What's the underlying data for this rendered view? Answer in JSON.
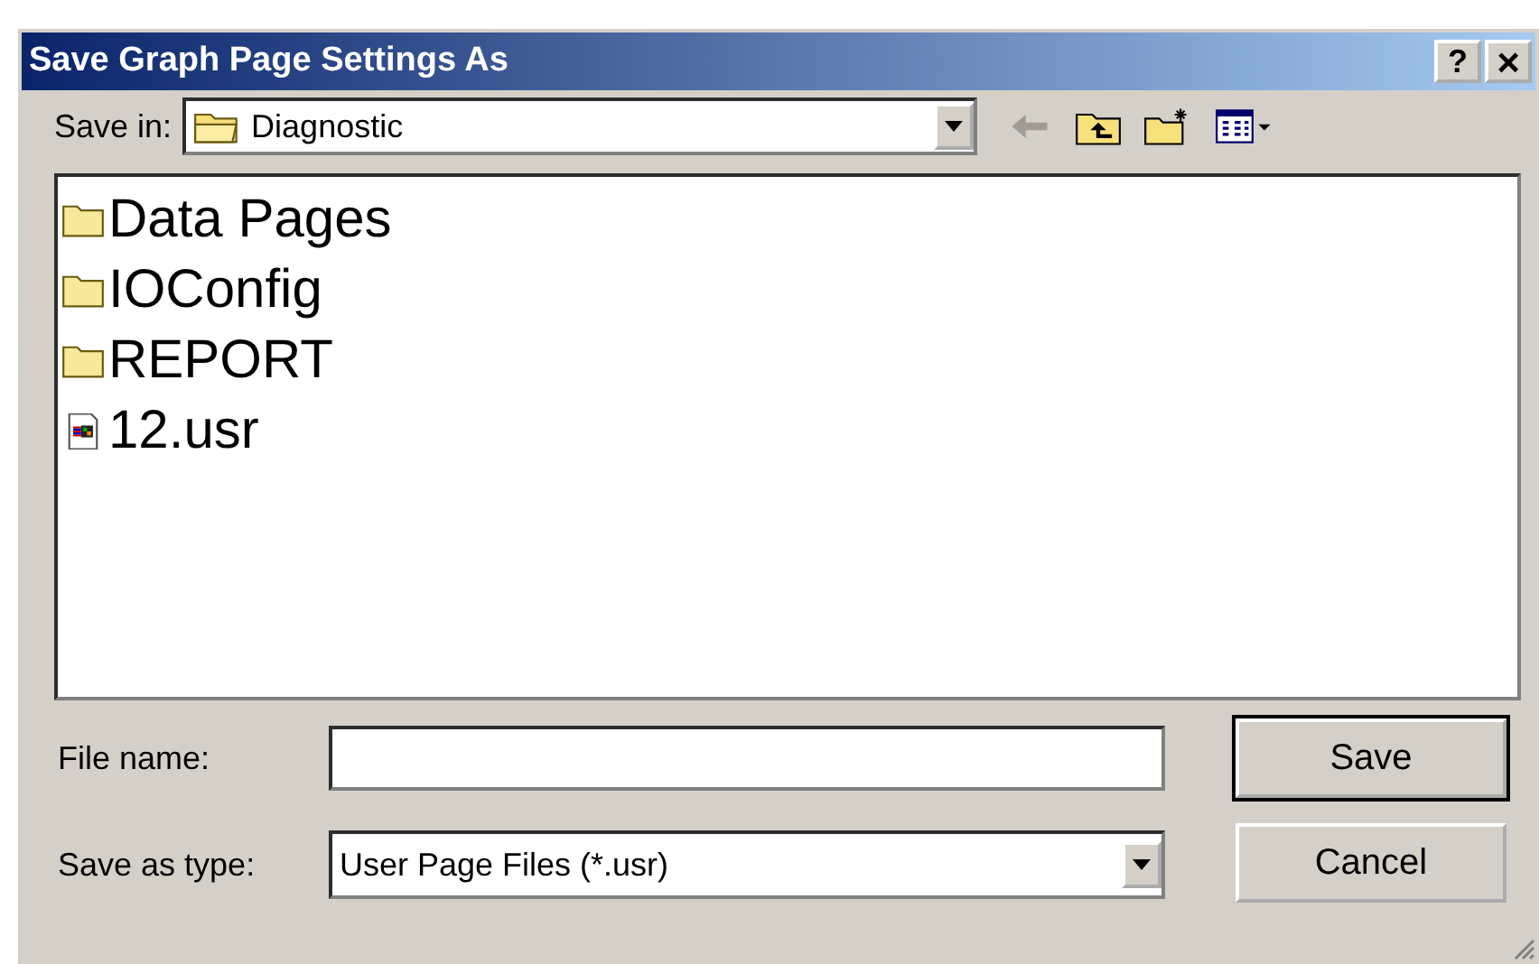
{
  "window": {
    "title": "Save Graph Page Settings As",
    "buttons": [
      {
        "kind": "help",
        "label": "?"
      },
      {
        "kind": "close",
        "label": "×"
      }
    ]
  },
  "save_in": {
    "label": "Save in:",
    "value": "Diagnostic"
  },
  "files": [
    {
      "name": "Data Pages",
      "kind": "folder"
    },
    {
      "name": "IOConfig",
      "kind": "folder"
    },
    {
      "name": "REPORT",
      "kind": "folder"
    },
    {
      "name": "12.usr",
      "kind": "file"
    }
  ],
  "file_name": {
    "label": "File name:"
  },
  "save_as_type": {
    "label": "Save as type:",
    "value": "User Page Files (*.usr)"
  },
  "buttons": [
    {
      "label": "Save",
      "default": true
    },
    {
      "label": "Cancel",
      "default": false
    }
  ]
}
